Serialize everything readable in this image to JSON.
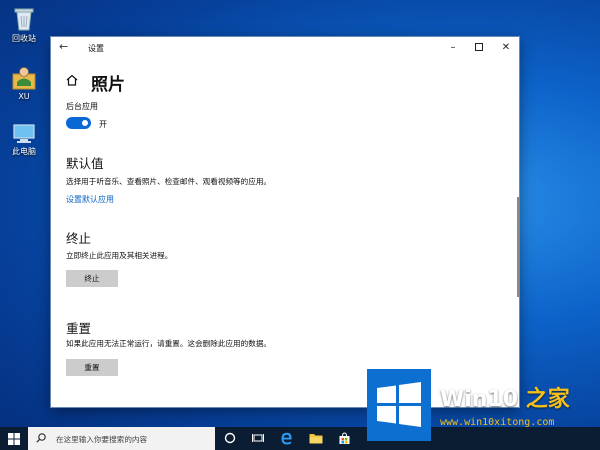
{
  "desktop": {
    "icons": [
      {
        "label": "回收站",
        "icon": "recycle-bin-icon"
      },
      {
        "label": "XU",
        "icon": "user-folder-icon"
      },
      {
        "label": "此电脑",
        "icon": "this-pc-icon"
      }
    ]
  },
  "window": {
    "title": "设置",
    "back_icon": "back-arrow-icon",
    "controls": [
      "minimize",
      "maximize",
      "close"
    ]
  },
  "settings": {
    "page_title": "照片",
    "background_apps": {
      "label": "后台应用",
      "toggle_state": "开",
      "is_on": true
    },
    "defaults": {
      "heading": "默认值",
      "description": "选择用于听音乐、查看照片、检查邮件、观看视频等的应用。",
      "link": "设置默认应用"
    },
    "terminate": {
      "heading": "终止",
      "description": "立即终止此应用及其相关进程。",
      "button": "终止"
    },
    "reset": {
      "heading": "重置",
      "description": "如果此应用无法正常运行，请重置。这会删除此应用的数据。",
      "button": "重置"
    }
  },
  "taskbar": {
    "search_placeholder": "在这里输入你要搜索的内容",
    "pinned": [
      "task-view-icon",
      "edge-icon",
      "file-explorer-icon",
      "store-icon"
    ]
  },
  "watermark": {
    "brand_prefix": "Win10",
    "brand_suffix": "之家",
    "url": "www.win10xitong.com"
  },
  "colors": {
    "accent": "#0a68d4",
    "link": "#0a63c9",
    "button_bg": "#cccccc",
    "taskbar_bg": "#0b1d33",
    "watermark_yellow": "#f6c01a"
  }
}
